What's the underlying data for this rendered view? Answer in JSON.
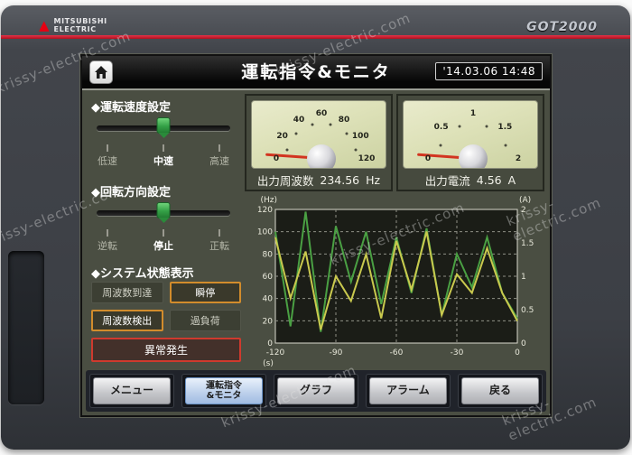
{
  "watermark": "krissy-electric.com",
  "device": {
    "logo": {
      "maker_line1": "MITSUBISHI",
      "maker_line2": "ELECTRIC"
    },
    "model_logo": "GOT2000"
  },
  "titlebar": {
    "title": "運転指令&モニタ",
    "datetime": "'14.03.06 14:48"
  },
  "speed_section": {
    "heading": "◆運転速度設定",
    "options": [
      {
        "label": "低速"
      },
      {
        "label": "中速"
      },
      {
        "label": "高速"
      }
    ],
    "selected": "中速"
  },
  "direction_section": {
    "heading": "◆回転方向設定",
    "options": [
      {
        "label": "逆転"
      },
      {
        "label": "停止"
      },
      {
        "label": "正転"
      }
    ],
    "selected": "停止"
  },
  "status_section": {
    "heading": "◆システム状態表示",
    "indicators": [
      {
        "label": "周波数到達",
        "state": "off"
      },
      {
        "label": "瞬停",
        "state": "warn"
      },
      {
        "label": "周波数検出",
        "state": "warn"
      },
      {
        "label": "過負荷",
        "state": "off"
      },
      {
        "label": "異常発生",
        "state": "alarm"
      }
    ]
  },
  "meters": [
    {
      "label": "出力周波数",
      "value": "234.56",
      "unit": "Hz",
      "scale": [
        "0",
        "20",
        "40",
        "60",
        "80",
        "100",
        "120"
      ],
      "needle_color": "#d23420"
    },
    {
      "label": "出力電流",
      "value": "4.56",
      "unit": "A",
      "scale": [
        "0",
        "0.5",
        "1",
        "1.5",
        "2"
      ],
      "needle_color": "#d23420"
    }
  ],
  "chart_data": {
    "type": "line",
    "x_label": "(s)",
    "y_left_label": "(Hz)",
    "y_right_label": "(A)",
    "x_range": [
      -120,
      0
    ],
    "y_left_range": [
      0,
      120
    ],
    "y_right_range": [
      0,
      2
    ],
    "x_ticks": [
      -120,
      -90,
      -60,
      -30,
      0
    ],
    "y_left_ticks": [
      0,
      20,
      40,
      60,
      80,
      100,
      120
    ],
    "y_right_ticks": [
      0,
      0.5,
      1,
      1.5,
      2
    ],
    "grid": "dashed",
    "plot_bg": "#1b1d17",
    "x": [
      -120,
      -112.5,
      -105,
      -97.5,
      -90,
      -82.5,
      -75,
      -67.5,
      -60,
      -52.5,
      -45,
      -37.5,
      -30,
      -22.5,
      -15,
      -7.5,
      0
    ],
    "series": [
      {
        "name": "series-green",
        "axis": "left",
        "color": "#4aa043",
        "values": [
          100,
          15,
          118,
          10,
          105,
          55,
          100,
          35,
          95,
          45,
          103,
          25,
          80,
          50,
          95,
          45,
          22
        ]
      },
      {
        "name": "series-yellow",
        "axis": "right",
        "color": "#c9c94e",
        "values": [
          1.58,
          0.67,
          1.37,
          0.2,
          1.0,
          0.63,
          1.33,
          0.37,
          1.53,
          0.8,
          1.67,
          0.42,
          1.03,
          0.75,
          1.42,
          0.75,
          0.33
        ]
      }
    ]
  },
  "nav": {
    "buttons": [
      {
        "label": "メニュー",
        "active": false
      },
      {
        "label": "運転指令\n&モニタ",
        "active": true
      },
      {
        "label": "グラフ",
        "active": false
      },
      {
        "label": "アラーム",
        "active": false
      },
      {
        "label": "戻る",
        "active": false
      }
    ]
  }
}
